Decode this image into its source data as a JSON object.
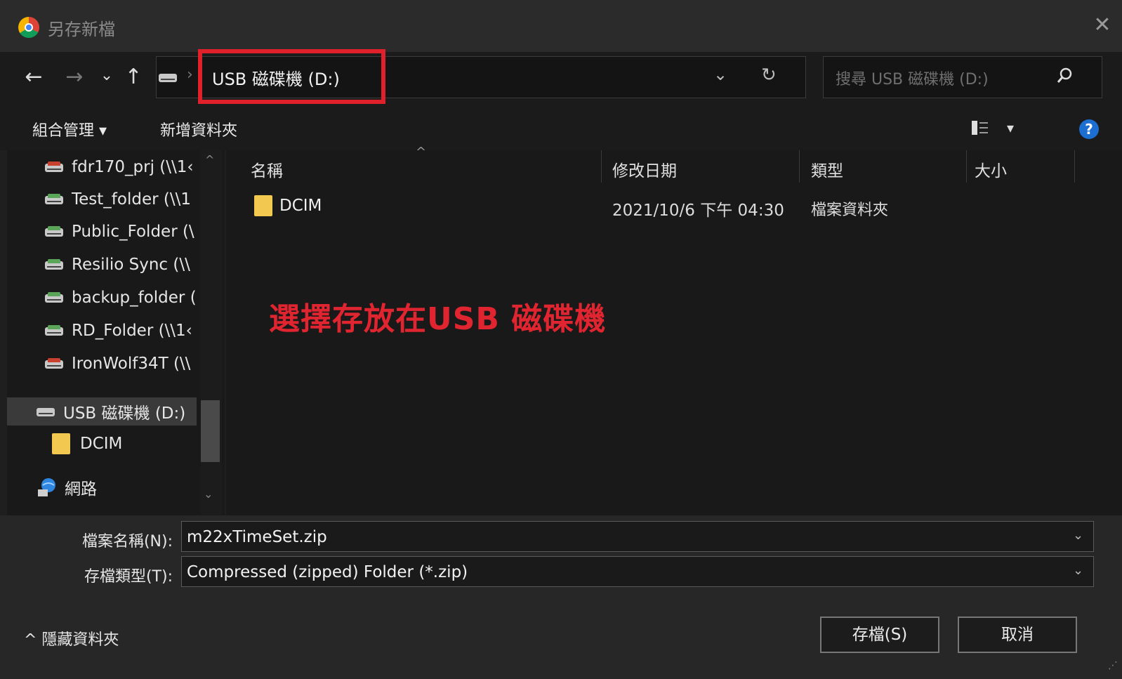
{
  "window": {
    "title": "另存新檔",
    "close_glyph": "✕"
  },
  "nav": {
    "back_glyph": "←",
    "forward_glyph": "→",
    "recent_glyph": "⌄",
    "up_glyph": "↑",
    "breadcrumb_sep": "›",
    "address": "USB 磁碟機 (D:)",
    "address_dropdown_glyph": "⌄",
    "refresh_glyph": "↻",
    "search_placeholder": "搜尋 USB 磁碟機 (D:)"
  },
  "commands": {
    "organize": "組合管理 ▾",
    "new_folder": "新增資料夾",
    "view_glyph": "▾",
    "help": "?"
  },
  "sidebar": {
    "items": [
      {
        "label": "fdr170_prj (\\\\1‹",
        "icon": "network-drive-disconnected-icon"
      },
      {
        "label": "Test_folder (\\\\1",
        "icon": "network-drive-icon"
      },
      {
        "label": "Public_Folder (\\",
        "icon": "network-drive-icon"
      },
      {
        "label": "Resilio Sync (\\\\",
        "icon": "network-drive-icon"
      },
      {
        "label": "backup_folder (",
        "icon": "network-drive-icon"
      },
      {
        "label": "RD_Folder (\\\\1‹",
        "icon": "network-drive-icon"
      },
      {
        "label": "IronWolf34T (\\\\",
        "icon": "network-drive-disconnected-icon"
      }
    ],
    "usb": "USB 磁碟機 (D:)",
    "dcim": "DCIM",
    "network": "網路"
  },
  "list": {
    "columns": [
      "名稱",
      "修改日期",
      "類型",
      "大小"
    ],
    "rows": [
      {
        "name": "DCIM",
        "modified": "2021/10/6 下午 04:30",
        "type": "檔案資料夾",
        "size": ""
      }
    ]
  },
  "annotation": "選擇存放在USB 磁碟機",
  "form": {
    "filename_label": "檔案名稱(N):",
    "filename": "m22xTimeSet.zip",
    "filetype_label": "存檔類型(T):",
    "filetype": "Compressed (zipped) Folder (*.zip)",
    "arrow": "⌄"
  },
  "buttons": {
    "save": "存檔(S)",
    "cancel": "取消"
  },
  "hide_folders": "^  隱藏資料夾",
  "colors": {
    "highlight": "#e0202b",
    "annotation": "#e02530"
  }
}
